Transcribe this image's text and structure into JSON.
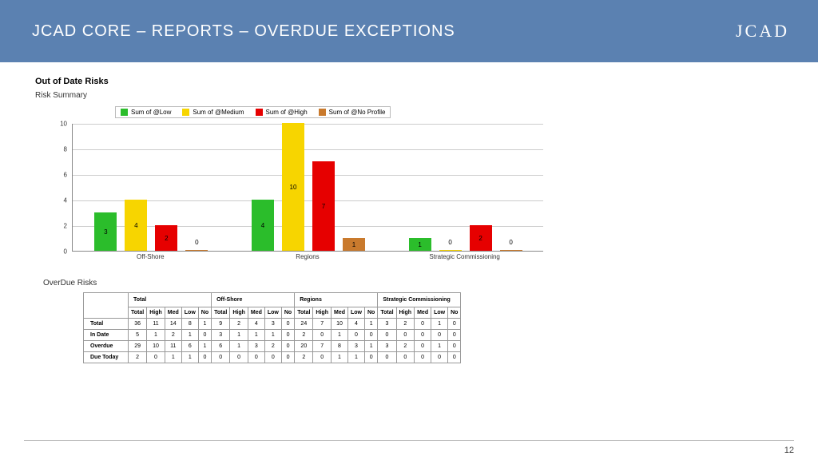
{
  "header": {
    "title": "JCAD CORE – REPORTS – OVERDUE EXCEPTIONS",
    "logo": "JCAD"
  },
  "page_number": "12",
  "section": {
    "title": "Out of Date Risks",
    "chart_title": "Risk Summary",
    "table_title": "OverDue Risks"
  },
  "chart_data": {
    "type": "bar",
    "title": "Risk Summary",
    "ylabel": "",
    "xlabel": "",
    "ylim": [
      0,
      10
    ],
    "yticks": [
      0,
      2,
      4,
      6,
      8,
      10
    ],
    "categories": [
      "Off-Shore",
      "Regions",
      "Strategic Commissioning"
    ],
    "series": [
      {
        "name": "Sum of @Low",
        "color": "#2bbd2b",
        "values": [
          3,
          4,
          1
        ]
      },
      {
        "name": "Sum of @Medium",
        "color": "#f7d500",
        "values": [
          4,
          10,
          0
        ]
      },
      {
        "name": "Sum of @High",
        "color": "#e60000",
        "values": [
          2,
          7,
          2
        ]
      },
      {
        "name": "Sum of @No Profile",
        "color": "#c97a2d",
        "values": [
          0,
          1,
          0
        ]
      }
    ]
  },
  "table": {
    "groups": [
      "Total",
      "Off-Shore",
      "Regions",
      "Strategic Commissioning"
    ],
    "subcols": [
      "Total",
      "High",
      "Med",
      "Low",
      "No"
    ],
    "rows": [
      {
        "label": "Total",
        "cells": [
          36,
          11,
          14,
          8,
          1,
          9,
          2,
          4,
          3,
          0,
          24,
          7,
          10,
          4,
          1,
          3,
          2,
          0,
          1,
          0
        ]
      },
      {
        "label": "In Date",
        "cells": [
          5,
          1,
          2,
          1,
          0,
          3,
          1,
          1,
          1,
          0,
          2,
          0,
          1,
          0,
          0,
          0,
          0,
          0,
          0,
          0
        ]
      },
      {
        "label": "Overdue",
        "cells": [
          29,
          10,
          11,
          6,
          1,
          6,
          1,
          3,
          2,
          0,
          20,
          7,
          8,
          3,
          1,
          3,
          2,
          0,
          1,
          0
        ]
      },
      {
        "label": "Due Today",
        "cells": [
          2,
          0,
          1,
          1,
          0,
          0,
          0,
          0,
          0,
          0,
          2,
          0,
          1,
          1,
          0,
          0,
          0,
          0,
          0,
          0
        ]
      }
    ]
  }
}
